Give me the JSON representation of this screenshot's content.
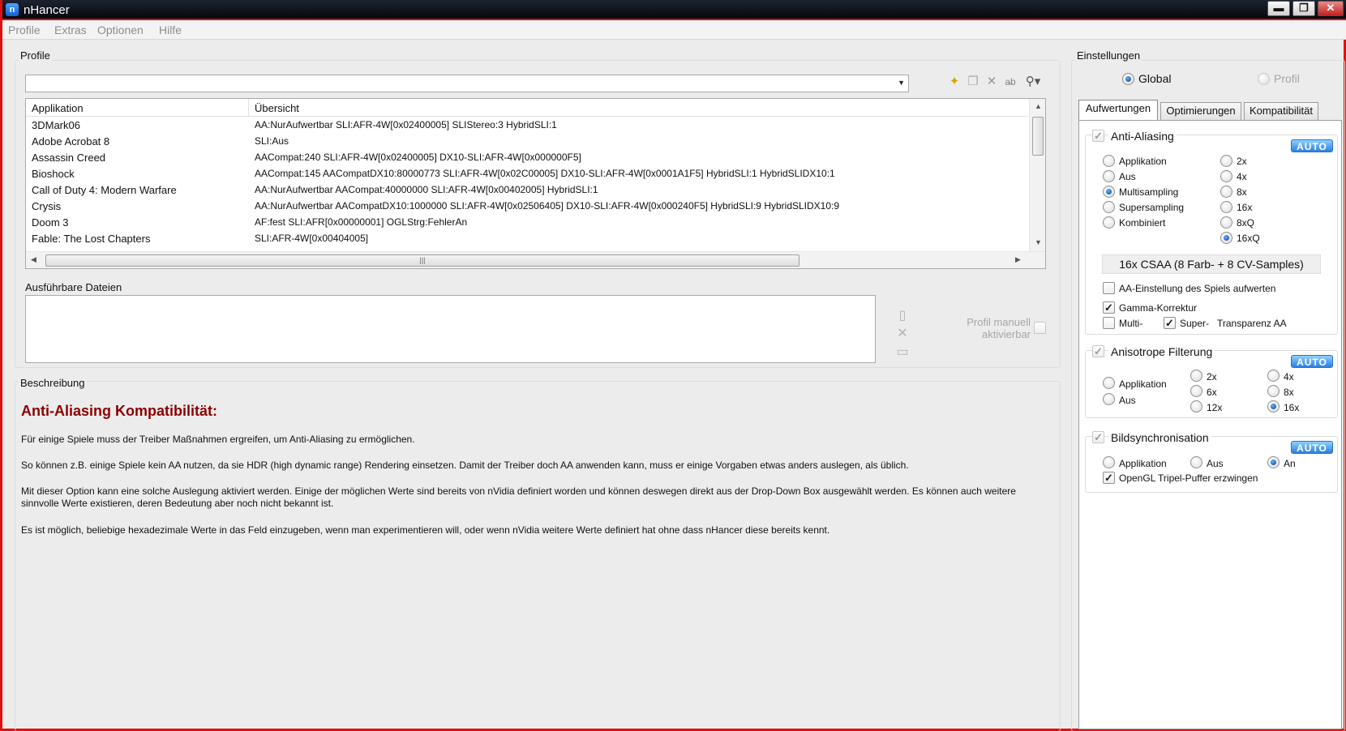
{
  "window": {
    "title": "nHancer",
    "min_label": "▬",
    "restore_label": "❐",
    "close_label": "✕"
  },
  "menu": {
    "items": [
      "Profile",
      "Extras",
      "Optionen",
      "Hilfe"
    ]
  },
  "profiles": {
    "title": "Profile",
    "selected_profile": "",
    "table": {
      "headers": [
        "Applikation",
        "Übersicht"
      ],
      "rows": [
        {
          "app": "3DMark06",
          "summary": "AA:NurAufwertbar SLI:AFR-4W[0x02400005] SLIStereo:3 HybridSLI:1"
        },
        {
          "app": "Adobe Acrobat 8",
          "summary": "SLI:Aus"
        },
        {
          "app": "Assassin Creed",
          "summary": "AACompat:240 SLI:AFR-4W[0x02400005] DX10-SLI:AFR-4W[0x000000F5]"
        },
        {
          "app": "Bioshock",
          "summary": "AACompat:145 AACompatDX10:80000773 SLI:AFR-4W[0x02C00005] DX10-SLI:AFR-4W[0x0001A1F5] HybridSLI:1 HybridSLIDX10:1"
        },
        {
          "app": "Call of Duty 4: Modern Warfare",
          "summary": "AA:NurAufwertbar AACompat:40000000 SLI:AFR-4W[0x00402005] HybridSLI:1"
        },
        {
          "app": "Crysis",
          "summary": "AA:NurAufwertbar AACompatDX10:1000000 SLI:AFR-4W[0x02506405] DX10-SLI:AFR-4W[0x000240F5] HybridSLI:9 HybridSLIDX10:9"
        },
        {
          "app": "Doom 3",
          "summary": "AF:fest SLI:AFR[0x00000001] OGLStrg:FehlerAn"
        },
        {
          "app": "Fable: The Lost Chapters",
          "summary": "SLI:AFR-4W[0x00404005]"
        }
      ]
    },
    "executables": {
      "title": "Ausführbare Dateien",
      "manual_label_1": "Profil manuell",
      "manual_label_2": "aktivierbar"
    }
  },
  "description": {
    "title": "Beschreibung",
    "heading": "Anti-Aliasing Kompatibilität:",
    "paragraphs": [
      "Für einige Spiele muss der Treiber Maßnahmen ergreifen, um Anti-Aliasing zu ermöglichen.",
      "So können z.B. einige Spiele kein AA nutzen, da sie HDR (high dynamic range) Rendering einsetzen. Damit der Treiber doch AA anwenden kann, muss er einige Vorgaben etwas anders auslegen, als üblich.",
      "Mit dieser Option kann eine solche Auslegung aktiviert werden. Einige der möglichen Werte sind bereits von nVidia definiert worden und können deswegen direkt aus der Drop-Down Box ausgewählt werden. Es können auch weitere sinnvolle Werte existieren, deren Bedeutung aber noch nicht bekannt ist.",
      "Es ist möglich, beliebige hexadezimale Werte in das Feld einzugeben, wenn man experimentieren will, oder wenn nVidia weitere Werte definiert hat ohne dass nHancer diese bereits kennt."
    ]
  },
  "settings": {
    "title": "Einstellungen",
    "scope_global": "Global",
    "scope_profile": "Profil",
    "tabs": [
      "Aufwertungen",
      "Optimierungen",
      "Kompatibilität"
    ],
    "auto_label": "AUTO",
    "aa": {
      "title": "Anti-Aliasing",
      "modes": [
        "Applikation",
        "Aus",
        "Multisampling",
        "Supersampling",
        "Kombiniert"
      ],
      "selected_mode": "Multisampling",
      "levels": [
        "2x",
        "4x",
        "8x",
        "16x",
        "8xQ",
        "16xQ"
      ],
      "selected_level": "16xQ",
      "info": "16x CSAA (8 Farb- + 8 CV-Samples)",
      "enhance_label": "AA-Einstellung des Spiels aufwerten",
      "gamma_label": "Gamma-Korrektur",
      "multi_label": "Multi-",
      "super_label": "Super-",
      "transparency_label": "Transparenz AA"
    },
    "af": {
      "title": "Anisotrope Filterung",
      "modes": [
        "Applikation",
        "Aus"
      ],
      "levels": [
        "2x",
        "4x",
        "6x",
        "8x",
        "12x",
        "16x"
      ],
      "selected_level": "16x"
    },
    "vsync": {
      "title": "Bildsynchronisation",
      "options": [
        "Applikation",
        "Aus",
        "An"
      ],
      "selected": "An",
      "triple_buffer_label": "OpenGL Tripel-Puffer erzwingen"
    }
  }
}
